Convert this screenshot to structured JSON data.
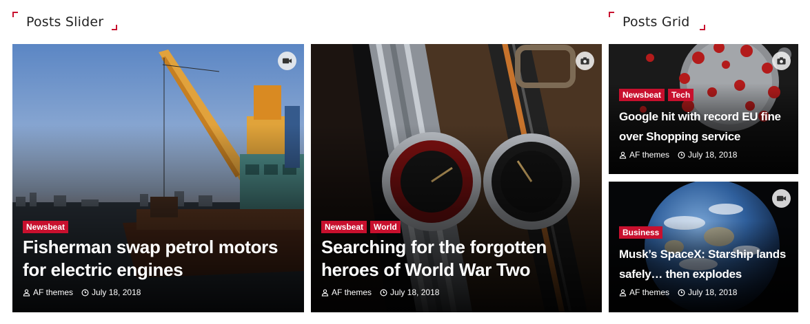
{
  "sections": {
    "slider_title": "Posts Slider",
    "grid_title": "Posts Grid"
  },
  "colors": {
    "accent": "#c8102e"
  },
  "posts": [
    {
      "media_icon": "video-icon",
      "categories": [
        "Newsbeat"
      ],
      "title": "Fisherman swap petrol motors for electric engines",
      "author": "AF themes",
      "date": "July 18, 2018"
    },
    {
      "media_icon": "camera-icon",
      "categories": [
        "Newsbeat",
        "World"
      ],
      "title": "Searching for the forgotten heroes of World War Two",
      "author": "AF themes",
      "date": "July 18, 2018"
    },
    {
      "media_icon": "camera-icon",
      "categories": [
        "Newsbeat",
        "Tech"
      ],
      "title": "Google hit with record EU fine over Shopping service",
      "author": "AF themes",
      "date": "July 18, 2018"
    },
    {
      "media_icon": "video-icon",
      "categories": [
        "Business"
      ],
      "title": "Musk’s SpaceX: Starship lands safely… then explodes",
      "author": "AF themes",
      "date": "July 18, 2018"
    }
  ]
}
